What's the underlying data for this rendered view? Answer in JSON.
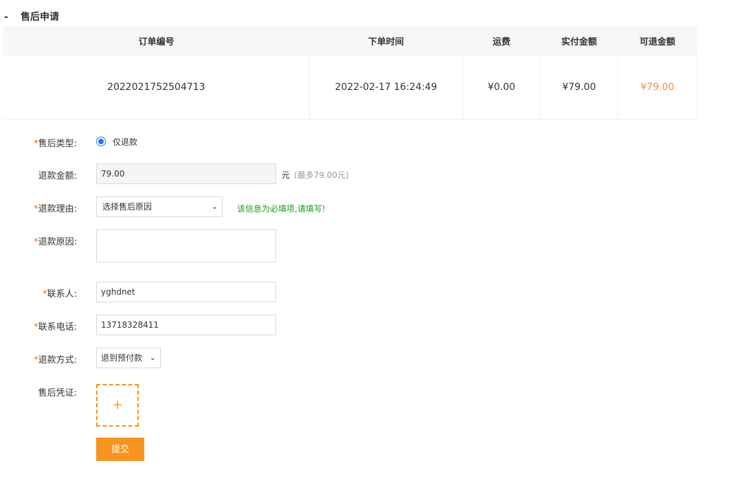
{
  "section": {
    "title": "售后申请",
    "toggle": "-"
  },
  "order_table": {
    "headers": [
      "订单编号",
      "下单时间",
      "运费",
      "实付金额",
      "可退金额"
    ],
    "row": {
      "order_no": "2022021752504713",
      "time": "2022-02-17 16:24:49",
      "shipping": "¥0.00",
      "paid": "¥79.00",
      "refundable": "¥79.00"
    }
  },
  "form": {
    "required_mark": "*",
    "type": {
      "label": "售后类型:",
      "option": "仅退款"
    },
    "amount": {
      "label": "退款金额:",
      "value": "79.00",
      "unit": "元",
      "max_hint": "(最多79.00元)"
    },
    "reason": {
      "label": "退款理由:",
      "selected": "选择售后原因",
      "hint": "该信息为必填项,请填写!"
    },
    "cause": {
      "label": "退款原因:",
      "value": ""
    },
    "contact": {
      "label": "联系人:",
      "value": "yghdnet"
    },
    "phone": {
      "label": "联系电话:",
      "value": "13718328411"
    },
    "method": {
      "label": "退款方式:",
      "selected": "退到预付款"
    },
    "proof": {
      "label": "售后凭证:",
      "plus": "+"
    },
    "submit_label": "提交"
  },
  "colors": {
    "accent": "#f7931e",
    "price": "#ff8a3d",
    "hint": "#12a012"
  }
}
